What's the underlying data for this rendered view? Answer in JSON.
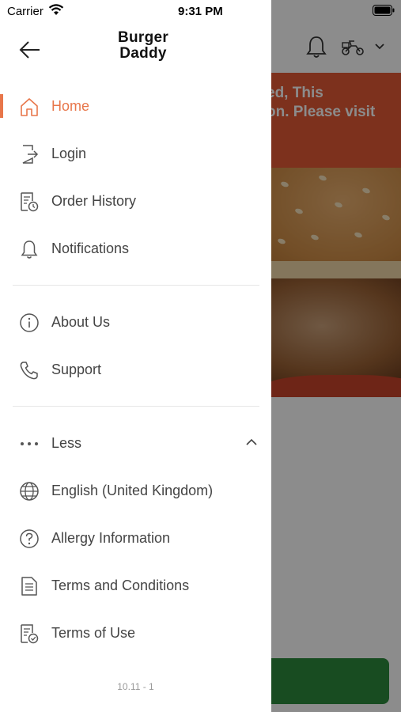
{
  "status_bar": {
    "carrier": "Carrier",
    "time": "9:31 PM"
  },
  "drawer": {
    "brand_line1": "Burger",
    "brand_line2": "Daddy",
    "menu": [
      {
        "label": "Home",
        "icon": "home-icon",
        "active": true
      },
      {
        "label": "Login",
        "icon": "login-icon"
      },
      {
        "label": "Order History",
        "icon": "order-history-icon"
      },
      {
        "label": "Notifications",
        "icon": "bell-icon"
      },
      {
        "label": "About Us",
        "icon": "info-icon"
      },
      {
        "label": "Support",
        "icon": "phone-icon"
      },
      {
        "label": "Less",
        "icon": "more-icon"
      },
      {
        "label": "English (United Kingdom)",
        "icon": "globe-icon"
      },
      {
        "label": "Allergy Information",
        "icon": "question-icon"
      },
      {
        "label": "Terms and Conditions",
        "icon": "document-icon"
      },
      {
        "label": "Terms of Use",
        "icon": "document-check-icon"
      }
    ],
    "version": "10.11 - 1"
  },
  "background": {
    "banner_line1": "ed, This",
    "banner_line2": "on. Please visit",
    "banner_line3": "/"
  },
  "colors": {
    "accent": "#e8764a",
    "banner": "#e35a35",
    "button": "#2c8a3c"
  }
}
